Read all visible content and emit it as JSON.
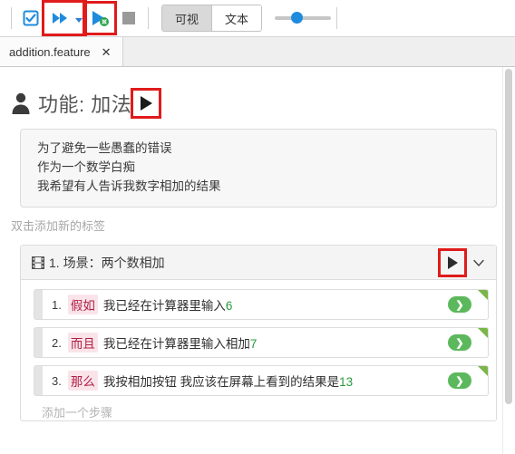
{
  "toolbar": {
    "check_icon": "checkbox-checked-icon",
    "run_all_icon": "fast-forward-icon",
    "run_all_dropdown_icon": "caret-down-icon",
    "debug_icon": "play-debug-icon",
    "stop_icon": "stop-square-icon",
    "view_modes": [
      {
        "label": "可视",
        "active": true
      },
      {
        "label": "文本",
        "active": false
      }
    ],
    "slider": {
      "name": "zoom-slider",
      "value": 30
    },
    "colors": {
      "accent_blue": "#1f8bdd",
      "highlight_red": "#e01b1b",
      "stop_gray": "#9a9a9a",
      "debug_green": "#2aa44a"
    }
  },
  "tabs": [
    {
      "label": "addition.feature",
      "close": "✕",
      "active": true
    }
  ],
  "feature": {
    "icon": "person-icon",
    "title": "功能: 加法",
    "run_icon": "play-triangle-icon",
    "description": [
      "为了避免一些愚蠢的错误",
      "作为一个数学白痴",
      "我希望有人告诉我数字相加的结果"
    ],
    "tag_hint": "双击添加新的标签"
  },
  "scenario": {
    "icon": "film-strip-icon",
    "title": "1. 场景：两个数相加",
    "run_icon": "play-triangle-icon",
    "collapse_icon": "chevron-down-icon",
    "steps": [
      {
        "num": "1.",
        "keyword": "假如",
        "text": "我已经在计算器里输入",
        "value": "6",
        "run_label": "❯",
        "status_color": "#7ab648"
      },
      {
        "num": "2.",
        "keyword": "而且",
        "text": "我已经在计算器里输入相加",
        "value": "7",
        "run_label": "❯",
        "status_color": "#7ab648"
      },
      {
        "num": "3.",
        "keyword": "那么",
        "text": "我按相加按钮 我应该在屏幕上看到的结果是",
        "value": "13",
        "run_label": "❯",
        "status_color": "#7ab648"
      }
    ],
    "add_step_hint": "添加一个步骤"
  }
}
